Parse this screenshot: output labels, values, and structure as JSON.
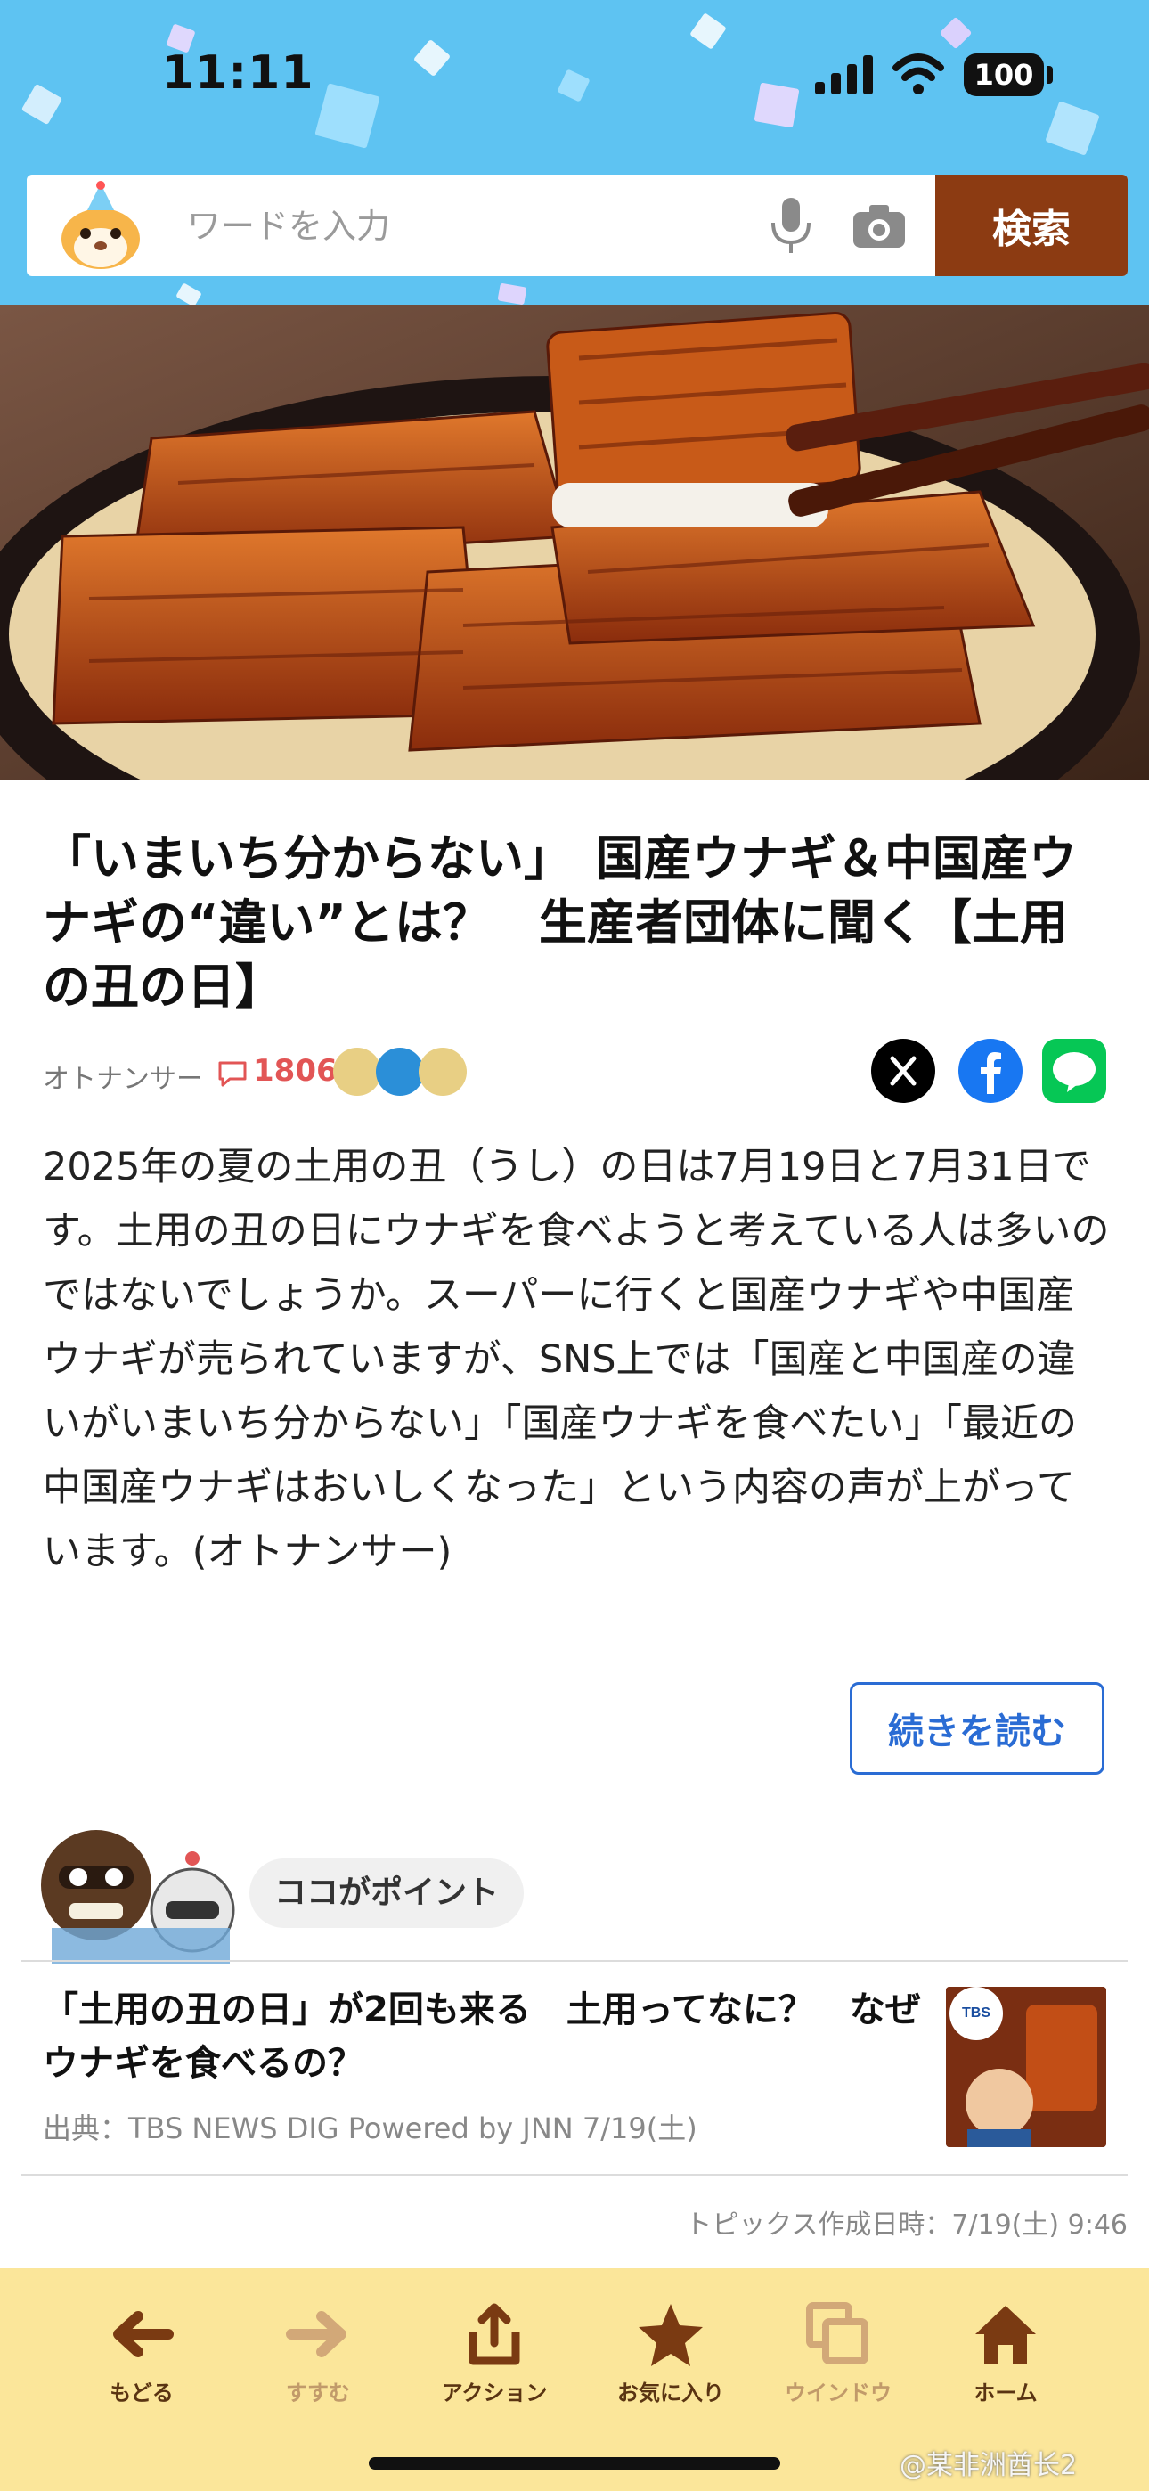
{
  "status": {
    "time": "11:11",
    "battery": "100"
  },
  "search": {
    "placeholder": "ワードを入力",
    "button_label": "検索"
  },
  "article": {
    "headline": "「いまいち分からない」　国産ウナギ＆中国産ウナギの“違い”とは？　生産者団体に聞く【土用の丑の日】",
    "source": "オトナンサー",
    "comment_count": "1806",
    "lead": "2025年の夏の土用の丑（うし）の日は7月19日と7月31日です。土用の丑の日にウナギを食べようと考えている人は多いのではないでしょうか。スーパーに行くと国産ウナギや中国産ウナギが売られていますが、SNS上では「国産と中国産の違いがいまいち分からない」「国産ウナギを食べたい」「最近の中国産ウナギはおいしくなった」という内容の声が上がっています。(オトナンサー)",
    "read_more": "続きを読む"
  },
  "point": {
    "label": "ココがポイント",
    "title": "「土用の丑の日」が2回も来る　土用ってなに？　なぜウナギを食べるの？",
    "source": "出典：TBS NEWS DIG Powered by JNN 7/19(土)",
    "thumb_text": "TBS"
  },
  "topic_created": "トピックス作成日時：7/19(土) 9:46",
  "toolbar": {
    "items": [
      {
        "label": "もどる",
        "icon": "arrow-left-icon",
        "enabled": true
      },
      {
        "label": "すすむ",
        "icon": "arrow-right-icon",
        "enabled": false
      },
      {
        "label": "アクション",
        "icon": "share-icon",
        "enabled": true
      },
      {
        "label": "お気に入り",
        "icon": "star-icon",
        "enabled": true
      },
      {
        "label": "ウインドウ",
        "icon": "window-icon",
        "enabled": false
      },
      {
        "label": "ホーム",
        "icon": "home-icon",
        "enabled": true
      }
    ]
  },
  "watermark": "@某非洲酋长2",
  "colors": {
    "header": "#5ec3f2",
    "search_button": "#8c3b12",
    "toolbar": "#fbe69a",
    "link": "#2a6cd4",
    "comment": "#e25555"
  }
}
